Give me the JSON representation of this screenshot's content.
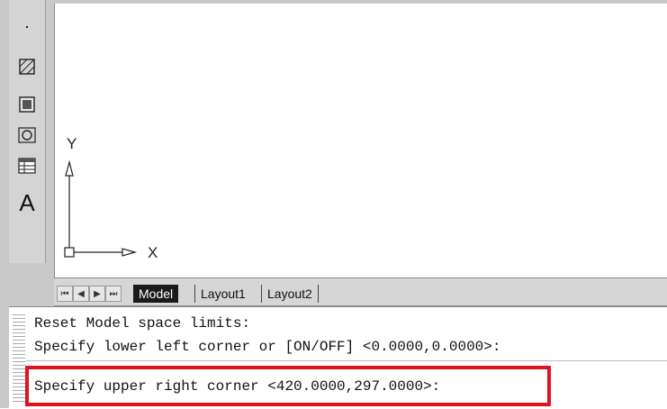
{
  "toolbar": {
    "tools": [
      {
        "icon": "dot-icon"
      },
      {
        "icon": "hatch-icon"
      },
      {
        "icon": "gradient-icon"
      },
      {
        "icon": "region-icon"
      },
      {
        "icon": "table-icon"
      },
      {
        "icon": "mtext-icon",
        "glyph": "A"
      }
    ]
  },
  "canvas": {
    "ucs": {
      "x_label": "X",
      "y_label": "Y"
    }
  },
  "tabs": {
    "nav_first": "⏮",
    "nav_prev": "◀",
    "nav_next": "▶",
    "nav_last": "⏭",
    "items": [
      {
        "label": "Model",
        "active": true
      },
      {
        "label": "Layout1",
        "active": false
      },
      {
        "label": "Layout2",
        "active": false
      }
    ]
  },
  "command": {
    "lines": [
      "Reset Model space limits:",
      "Specify lower left corner or [ON/OFF] <0.0000,0.0000>:",
      "Specify upper right corner <420.0000,297.0000>:"
    ]
  },
  "colors": {
    "highlight": "#e0141b"
  }
}
